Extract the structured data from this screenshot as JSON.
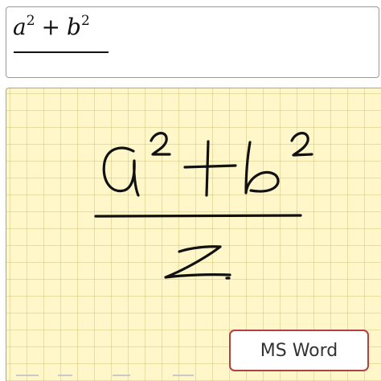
{
  "preview": {
    "numerator": {
      "base1": "a",
      "exp1": "2",
      "operator": "+",
      "base2": "b",
      "exp2": "2"
    }
  },
  "canvas": {
    "grid_color": "#c4b260",
    "background_color": "#fff7c9",
    "ink_color": "#111111"
  },
  "toolbar": {
    "export_label": "MS Word"
  },
  "colors": {
    "button_border": "#b3413e"
  }
}
